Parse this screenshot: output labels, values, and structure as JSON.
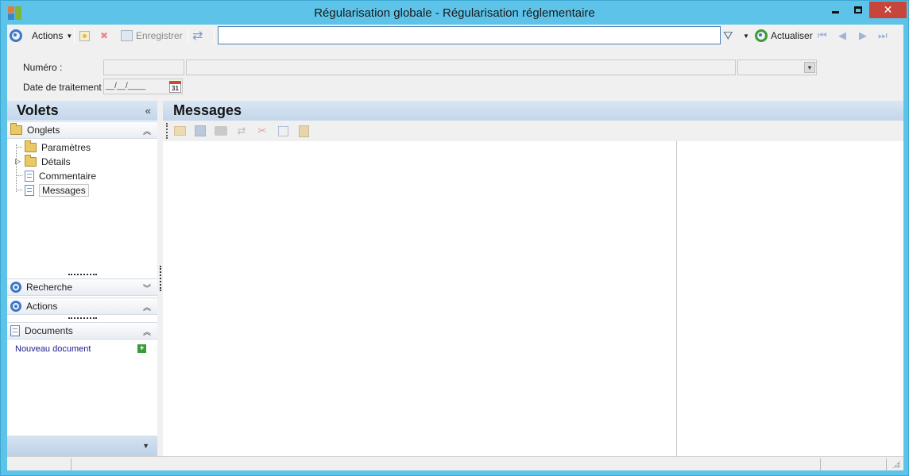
{
  "window": {
    "title": "Régularisation globale - Régularisation réglementaire"
  },
  "toolbar": {
    "actions_label": "Actions",
    "save_label": "Enregistrer",
    "search_value": "",
    "refresh_label": "Actualiser"
  },
  "form": {
    "numero_label": "Numéro :",
    "date_label": "Date de traitement :",
    "date_value": "__/__/____",
    "calendar_day": "31"
  },
  "left_panel": {
    "title": "Volets",
    "onglets": {
      "label": "Onglets",
      "items": [
        {
          "label": "Paramètres",
          "icon": "folder-icon"
        },
        {
          "label": "Détails",
          "icon": "folder-icon"
        },
        {
          "label": "Commentaire",
          "icon": "document-icon"
        },
        {
          "label": "Messages",
          "icon": "document-icon",
          "selected": true
        }
      ]
    },
    "recherche_label": "Recherche",
    "actions_label": "Actions",
    "documents": {
      "label": "Documents",
      "new_document_link": "Nouveau document"
    }
  },
  "content": {
    "title": "Messages"
  },
  "colors": {
    "window_frame": "#5ec3e8",
    "header_gradient": "#c4d6ea",
    "accent_blue": "#3b78c9",
    "close_button": "#c7453a",
    "link": "#1a1a8c"
  }
}
